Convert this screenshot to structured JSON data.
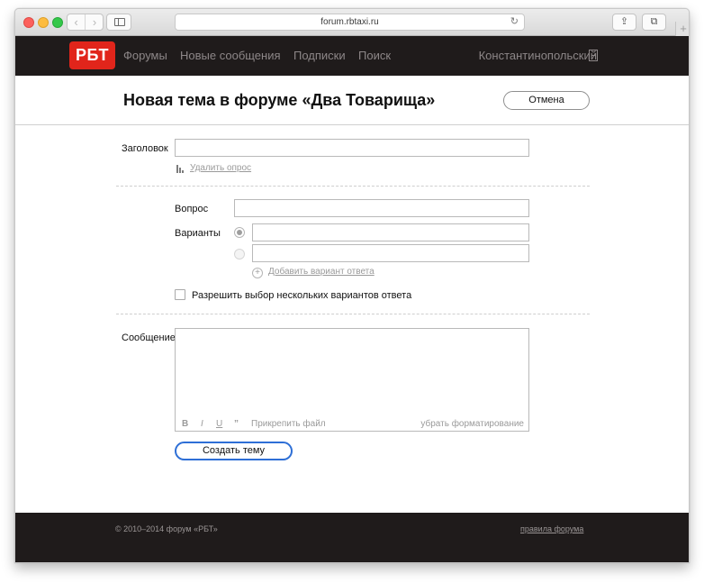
{
  "browser": {
    "url": "forum.rbtaxi.ru",
    "back_glyph": "‹",
    "forward_glyph": "›",
    "reload_glyph": "↻",
    "share_glyph": "⇪",
    "tabs_glyph": "⧉",
    "newtab_glyph": "+"
  },
  "header": {
    "logo": "РБТ",
    "nav": [
      "Форумы",
      "Новые сообщения",
      "Подписки",
      "Поиск"
    ],
    "user": "Константинопольский"
  },
  "page": {
    "title": "Новая тема в форуме «Два Товарища»",
    "cancel_label": "Отмена"
  },
  "form": {
    "subject_label": "Заголовок",
    "subject_value": "",
    "remove_poll": "Удалить опрос",
    "question_label": "Вопрос",
    "question_value": "",
    "options_label": "Варианты",
    "options": [
      "",
      ""
    ],
    "add_option": "Добавить вариант ответа",
    "multi_choice_label": "Разрешить выбор нескольких вариантов ответа",
    "multi_choice_checked": false,
    "message_label": "Сообщение",
    "message_value": "",
    "toolbar": {
      "bold": "B",
      "italic": "I",
      "underline": "U",
      "quote": "”",
      "attach": "Прикрепить файл",
      "clear_format": "убрать форматирование"
    },
    "submit_label": "Создать тему"
  },
  "footer": {
    "copyright": "© 2010–2014 форум «РБТ»",
    "rules": "правила форума"
  },
  "colors": {
    "header_bg": "#1f1b1b",
    "logo_red": "#e1251b",
    "submit_border": "#2e6fd6"
  }
}
